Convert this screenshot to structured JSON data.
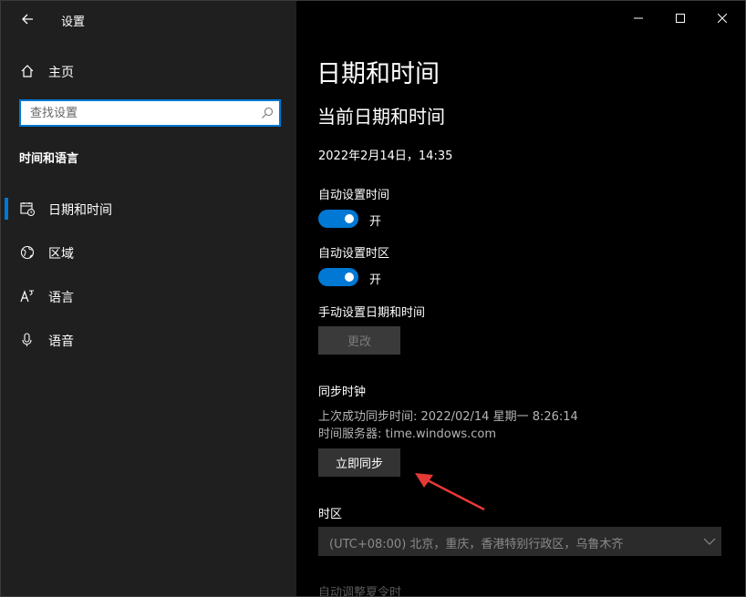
{
  "app": {
    "title": "设置"
  },
  "sidebar": {
    "home_label": "主页",
    "search_placeholder": "查找设置",
    "section_heading": "时间和语言",
    "items": [
      {
        "label": "日期和时间",
        "icon": "calendar-clock-icon",
        "active": true
      },
      {
        "label": "区域",
        "icon": "globe-icon",
        "active": false
      },
      {
        "label": "语言",
        "icon": "language-icon",
        "active": false
      },
      {
        "label": "语音",
        "icon": "microphone-icon",
        "active": false
      }
    ]
  },
  "main": {
    "page_title": "日期和时间",
    "current_heading": "当前日期和时间",
    "current_datetime": "2022年2月14日，14:35",
    "auto_time": {
      "label": "自动设置时间",
      "state": "开"
    },
    "auto_timezone": {
      "label": "自动设置时区",
      "state": "开"
    },
    "manual": {
      "label": "手动设置日期和时间",
      "button": "更改"
    },
    "sync": {
      "heading": "同步时钟",
      "last_sync": "上次成功同步时间: 2022/02/14 星期一 8:26:14",
      "server": "时间服务器: time.windows.com",
      "button": "立即同步"
    },
    "timezone": {
      "label": "时区",
      "value": "(UTC+08:00) 北京，重庆，香港特别行政区，乌鲁木齐"
    },
    "dst_label": "自动调整夏令时"
  },
  "colors": {
    "accent": "#0078d4",
    "annotation_arrow": "#e53935"
  }
}
